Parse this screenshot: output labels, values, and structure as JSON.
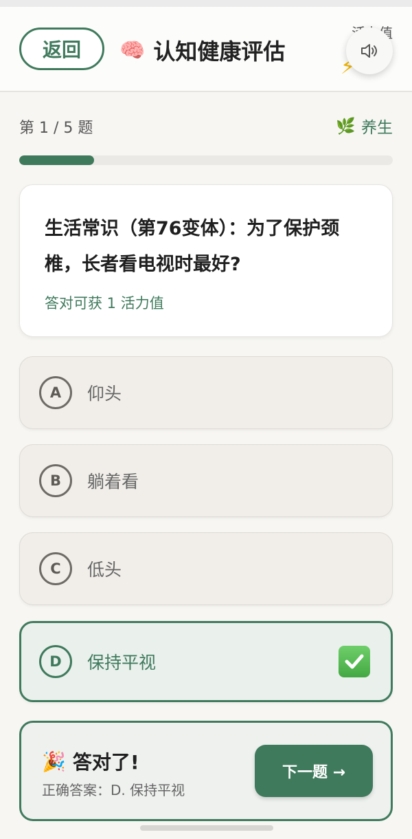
{
  "header": {
    "back_label": "返回",
    "title": "认知健康评估",
    "title_icon": "brain-icon",
    "vitality_label": "活力值",
    "vitality_icon": "bolt-icon",
    "sound_icon": "speaker-icon"
  },
  "progress": {
    "count_text": "第 1 / 5 题",
    "category_icon": "leaf-icon",
    "category": "养生",
    "fraction": 0.2,
    "accent_color": "#3f7a5c"
  },
  "question": {
    "text": "生活常识（第76变体）：为了保护颈椎，长者看电视时最好?",
    "reward": "答对可获 1 活力值"
  },
  "options": [
    {
      "letter": "A",
      "text": "仰头",
      "state": "normal"
    },
    {
      "letter": "B",
      "text": "躺着看",
      "state": "normal"
    },
    {
      "letter": "C",
      "text": "低头",
      "state": "normal"
    },
    {
      "letter": "D",
      "text": "保持平视",
      "state": "correct"
    }
  ],
  "result": {
    "title": "答对了!",
    "icon": "party-popper-icon",
    "answer_text": "正确答案：D. 保持平视",
    "next_label": "下一题 →"
  }
}
